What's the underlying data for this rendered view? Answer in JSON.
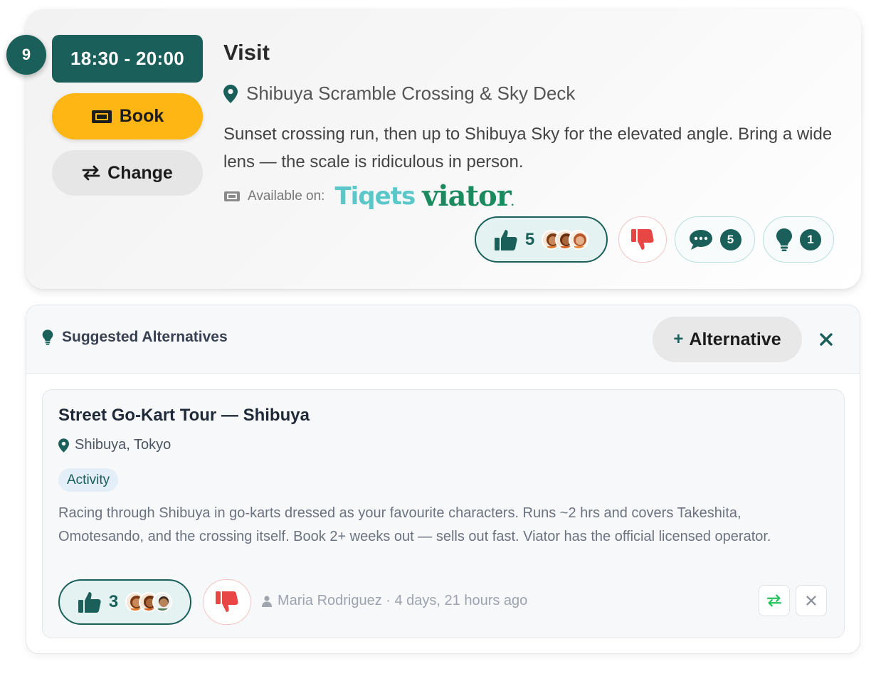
{
  "activity": {
    "step_number": "9",
    "time_range": "18:30 - 20:00",
    "book_label": "Book",
    "change_label": "Change",
    "title": "Visit",
    "location": "Shibuya Scramble Crossing & Sky Deck",
    "description": "Sunset crossing run, then up to Shibuya Sky for the elevated angle. Bring a wide lens — the scale is ridiculous in person.",
    "available_on_label": "Available on:",
    "providers": [
      "Tiqets",
      "viator"
    ],
    "likes": "5",
    "comments": "5",
    "ideas": "1"
  },
  "alternatives": {
    "header_title": "Suggested Alternatives",
    "add_label": "Alternative",
    "items": [
      {
        "name": "Street Go-Kart Tour — Shibuya",
        "location": "Shibuya, Tokyo",
        "tag": "Activity",
        "description": "Racing through Shibuya in go-karts dressed as your favourite characters. Runs ~2 hrs and covers Takeshita, Omotesando, and the crossing itself. Book 2+ weeks out — sells out fast. Viator has the official licensed operator.",
        "likes": "3",
        "author_meta": "Maria Rodriguez · 4 days, 21 hours ago"
      }
    ]
  },
  "colors": {
    "brand_teal": "#1a5f5a",
    "book_yellow": "#fdb614",
    "dislike_red": "#e84545",
    "swap_green": "#22c55e",
    "tiqets_cyan": "#5bc7c8",
    "viator_green": "#1b8a5e"
  },
  "icons": [
    "map-pin-icon",
    "ticket-icon",
    "swap-arrows-icon",
    "thumbs-up-icon",
    "thumbs-down-icon",
    "comment-icon",
    "lightbulb-icon",
    "close-icon",
    "user-icon"
  ]
}
